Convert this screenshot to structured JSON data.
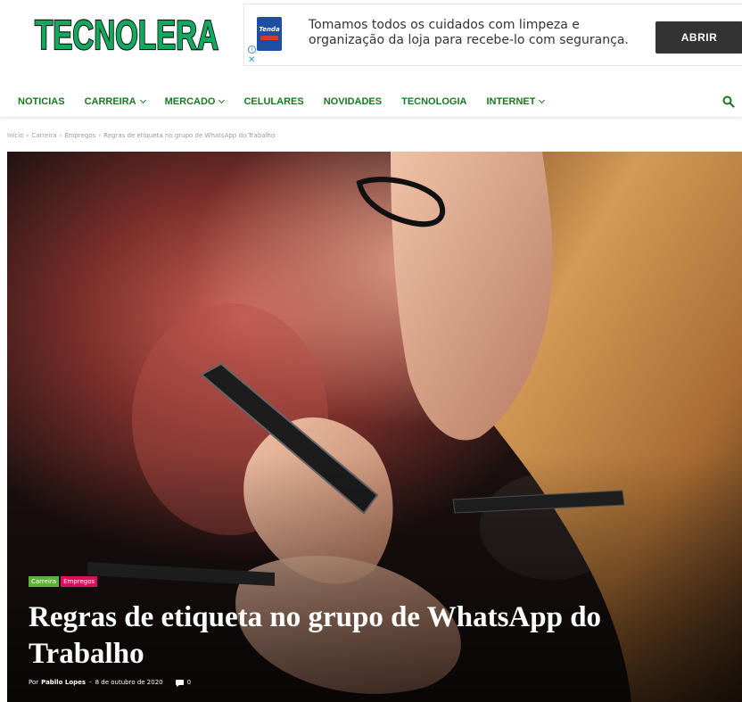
{
  "header": {
    "logo_text": "TECNOLERA",
    "logo_colors": {
      "fill": "#12a85d",
      "outline": "#0a0a0a"
    }
  },
  "ad": {
    "brand": "Tenda",
    "text": "Tomamos todos os cuidados com limpeza e organização da loja para recebe-lo com segurança.",
    "button": "ABRIR",
    "info_icon": "info-icon",
    "close_icon": "close-icon"
  },
  "nav": {
    "items": [
      {
        "label": "NOTICIAS",
        "dropdown": false
      },
      {
        "label": "CARREIRA",
        "dropdown": true
      },
      {
        "label": "MERCADO",
        "dropdown": true
      },
      {
        "label": "CELULARES",
        "dropdown": false
      },
      {
        "label": "NOVIDADES",
        "dropdown": false
      },
      {
        "label": "TECNOLOGIA",
        "dropdown": false
      },
      {
        "label": "INTERNET",
        "dropdown": true
      }
    ],
    "search_icon": "search-icon",
    "accent_color": "#19791d"
  },
  "breadcrumb": {
    "items": [
      "Início",
      "Carreira",
      "Empregos",
      "Regras de etiqueta no grupo de WhatsApp do Trabalho"
    ],
    "separator": "›"
  },
  "article": {
    "tags": [
      {
        "label": "Carreira",
        "color": "#5db33a"
      },
      {
        "label": "Empregos",
        "color": "#d7115b"
      }
    ],
    "title": "Regras de etiqueta no grupo de WhatsApp do Trabalho",
    "by": "Por",
    "author": "Pabllo Lopes",
    "dash": "-",
    "date": "8 de outubro de 2020",
    "comments": "0"
  }
}
